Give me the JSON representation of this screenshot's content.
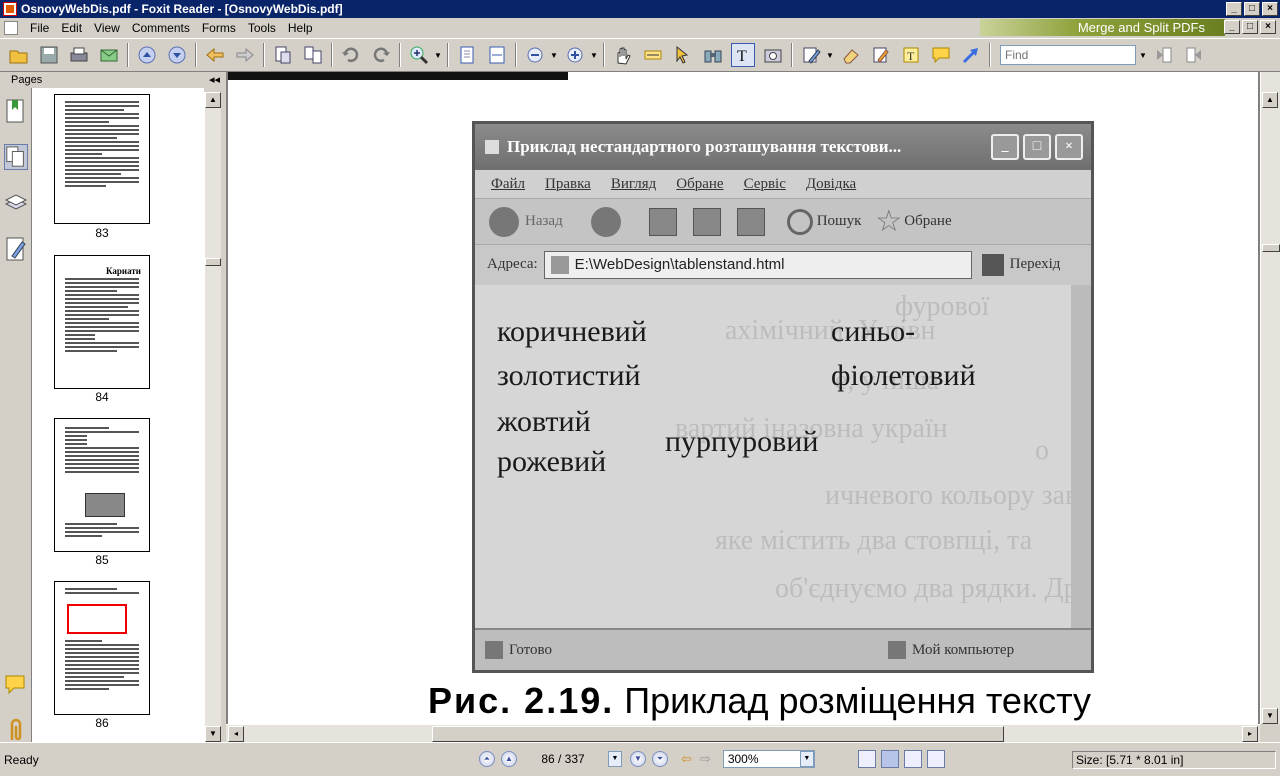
{
  "window": {
    "title": "OsnovyWebDis.pdf - Foxit Reader - [OsnovyWebDis.pdf]",
    "banner": "Merge and Split PDFs"
  },
  "menu": [
    "File",
    "Edit",
    "View",
    "Comments",
    "Forms",
    "Tools",
    "Help"
  ],
  "toolbar": {
    "find_placeholder": "Find",
    "icons": [
      "open-icon",
      "save-icon",
      "print-icon",
      "email-icon",
      "page-up-icon",
      "page-down-icon",
      "back-icon",
      "forward-icon",
      "extract-icon",
      "split-icon",
      "undo-icon",
      "redo-icon",
      "zoom-in-icon",
      "fit-page-icon",
      "fit-width-icon",
      "zoom-out-minus-icon",
      "zoom-in-plus-icon",
      "hand-icon",
      "select-text-icon",
      "arrow-icon",
      "binoculars-icon",
      "typewriter-icon",
      "snapshot-icon",
      "pen-icon",
      "eraser-icon",
      "highlighter-icon",
      "textbox-icon",
      "note-icon",
      "arrow-tool-icon"
    ]
  },
  "sidebar": {
    "header": "Pages",
    "thumbnails": [
      {
        "label": "83"
      },
      {
        "label": "84",
        "heading": "Кариати"
      },
      {
        "label": "85"
      },
      {
        "label": "86"
      }
    ]
  },
  "document": {
    "screenshot": {
      "title": "Приклад нестандартного розташування текстови...",
      "menu": [
        "Файл",
        "Правка",
        "Вигляд",
        "Обране",
        "Сервіс",
        "Довідка"
      ],
      "nav": {
        "back": "Назад",
        "search": "Пошук",
        "favorites": "Обране"
      },
      "address_label": "Адреса:",
      "address": "E:\\WebDesign\\tablenstand.html",
      "go": "Перехід",
      "words": [
        "коричневий",
        "синьо-",
        "фіолетовий",
        "золотистий",
        "жовтий",
        "пурпуровий",
        "рожевий"
      ],
      "status_left": "Готово",
      "status_right": "Мой компьютер"
    },
    "caption_bold": "Рис. 2.19.",
    "caption_text": " Приклад розміщення тексту"
  },
  "statusbar": {
    "ready": "Ready",
    "page": "86 / 337",
    "zoom": "300%",
    "size": "Size: [5.71 * 8.01 in]"
  }
}
